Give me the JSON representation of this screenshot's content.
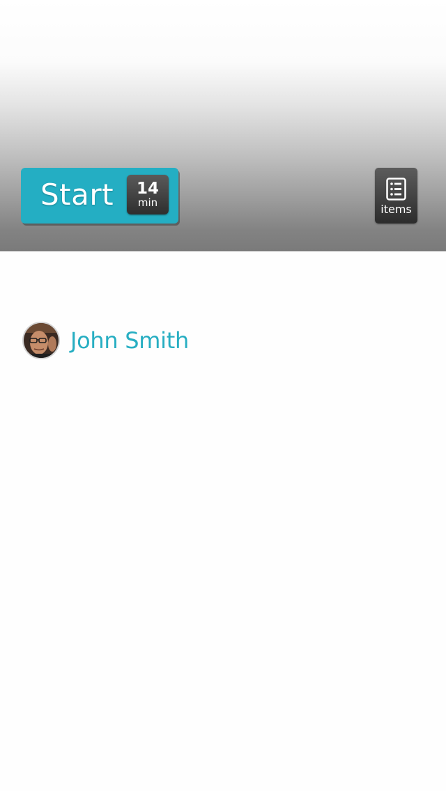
{
  "hero": {
    "start_button": {
      "label": "Start",
      "duration_value": "14",
      "duration_unit": "min"
    },
    "items_button": {
      "icon": "list-icon",
      "label": "items"
    }
  },
  "author": {
    "avatar_icon": "avatar",
    "name": "John Smith"
  },
  "colors": {
    "accent": "#24aec3",
    "author_name": "#27aec2",
    "badge_dark": "#2e2e2e"
  }
}
